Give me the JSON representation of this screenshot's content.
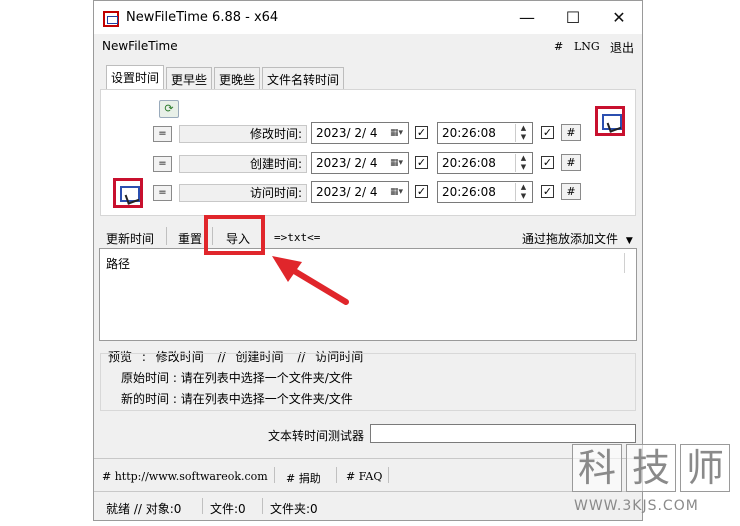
{
  "window": {
    "title": "NewFileTime 6.88 - x64"
  },
  "controls": {
    "minimize": "—",
    "maximize": "☐",
    "close": "✕"
  },
  "menu": {
    "app_name": "NewFileTime",
    "hash": "#",
    "lng": "LNG",
    "exit": "退出"
  },
  "tabs": [
    "设置时间",
    "更早些",
    "更晚些",
    "文件名转时间"
  ],
  "rows": [
    {
      "eq": "=",
      "label": "修改时间:",
      "date": "2023/ 2/ 4",
      "time": "20:26:08",
      "hash": "#"
    },
    {
      "eq": "=",
      "label": "创建时间:",
      "date": "2023/ 2/ 4",
      "time": "20:26:08",
      "hash": "#"
    },
    {
      "eq": "=",
      "label": "访问时间:",
      "date": "2023/ 2/ 4",
      "time": "20:26:08",
      "hash": "#"
    }
  ],
  "toolbar": {
    "update": "更新时间",
    "reset": "重置",
    "import": "导入",
    "txt": "=>txt<=",
    "drag_add": "通过拖放添加文件"
  },
  "list": {
    "header": "路径"
  },
  "preview": {
    "label": "预览",
    "colon": ":",
    "modified": "修改时间",
    "slash": "//",
    "created": "创建时间",
    "accessed": "访问时间",
    "original_label": "原始时间",
    "original_value": ": 请在列表中选择一个文件夹/文件",
    "new_label": "新的时间",
    "new_value": ": 请在列表中选择一个文件夹/文件"
  },
  "tester": {
    "label": "文本转时间测试器",
    "value": ""
  },
  "footer": {
    "url": "# http://www.softwareok.com",
    "donate": "# 捐助",
    "faq": "# FAQ"
  },
  "status": {
    "ready": "就绪 // 对象:0",
    "files": "文件:0",
    "folders": "文件夹:0"
  },
  "watermark": {
    "chars": [
      "科",
      "技",
      "师"
    ],
    "url": "WWW.3KJS.COM"
  },
  "colors": {
    "highlight": "#e0262b",
    "window_bg": "#f0f0f0"
  }
}
